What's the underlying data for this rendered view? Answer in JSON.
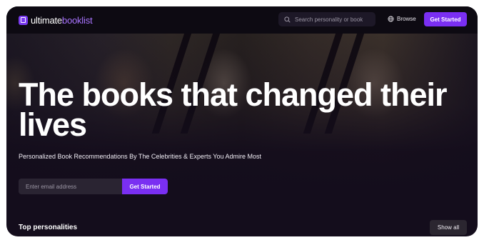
{
  "brand": {
    "name_primary": "ultimate",
    "name_accent": "booklist",
    "accent_color": "#7a2ff2"
  },
  "header": {
    "search_placeholder": "Search personality or book",
    "browse_label": "Browse",
    "cta_label": "Get Started"
  },
  "hero": {
    "headline": "The books that changed their lives",
    "subheadline": "Personalized Book Recommendations By The Celebrities & Experts You Admire Most",
    "email_placeholder": "Enter email address",
    "cta_label": "Get Started"
  },
  "personalities": {
    "title": "Top personalities",
    "show_all_label": "Show all"
  },
  "icons": {
    "logo": "book-logo-icon",
    "search": "search-icon",
    "browse": "globe-icon"
  }
}
